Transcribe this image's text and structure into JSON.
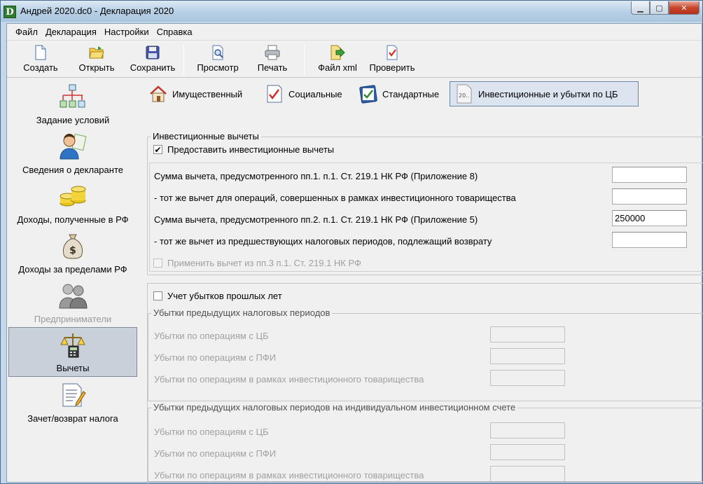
{
  "window": {
    "title": "Андрей 2020.dc0 - Декларация 2020",
    "app_icon_letter": "D"
  },
  "window_buttons": {
    "minimize": "▁",
    "maximize": "▢",
    "close": "✕"
  },
  "menu": [
    "Файл",
    "Декларация",
    "Настройки",
    "Справка"
  ],
  "toolbar": [
    {
      "label": "Создать",
      "icon": "new-document-icon"
    },
    {
      "label": "Открыть",
      "icon": "open-folder-icon"
    },
    {
      "label": "Сохранить",
      "icon": "save-disk-icon"
    },
    {
      "label": "Просмотр",
      "icon": "preview-icon"
    },
    {
      "label": "Печать",
      "icon": "printer-icon"
    },
    {
      "label": "Файл xml",
      "icon": "xml-file-icon"
    },
    {
      "label": "Проверить",
      "icon": "check-document-icon"
    }
  ],
  "sidebar": [
    {
      "label": "Задание условий",
      "icon": "conditions-tree-icon",
      "state": "normal"
    },
    {
      "label": "Сведения о декларанте",
      "icon": "person-icon",
      "state": "normal"
    },
    {
      "label": "Доходы, полученные в РФ",
      "icon": "coins-icon",
      "state": "normal"
    },
    {
      "label": "Доходы за пределами РФ",
      "icon": "money-bag-icon",
      "state": "normal"
    },
    {
      "label": "Предприниматели",
      "icon": "businessmen-icon",
      "state": "disabled"
    },
    {
      "label": "Вычеты",
      "icon": "scales-calculator-icon",
      "state": "active"
    },
    {
      "label": "Зачет/возврат налога",
      "icon": "document-pen-icon",
      "state": "normal"
    }
  ],
  "tabs": [
    {
      "label": "Имущественный",
      "icon": "house-icon",
      "active": false
    },
    {
      "label": "Социальные",
      "icon": "checklist-icon",
      "active": false
    },
    {
      "label": "Стандартные",
      "icon": "clipboard-check-icon",
      "active": false
    },
    {
      "label": "Инвестиционные и убытки по ЦБ",
      "icon": "document-20-icon",
      "active": true,
      "icon_text": "20.."
    }
  ],
  "investment": {
    "group_title": "Инвестиционные вычеты",
    "provide_checkbox": {
      "label": "Предоставить инвестиционные вычеты",
      "checked": true,
      "mark": "✔"
    },
    "rows": [
      {
        "label": "Сумма вычета, предусмотренного пп.1. п.1. Ст. 219.1 НК РФ (Приложение 8)",
        "value": ""
      },
      {
        "label": " - тот же вычет для операций, совершенных в рамках инвестиционного товарищества",
        "value": ""
      },
      {
        "label": "Сумма вычета, предусмотренного пп.2. п.1. Ст. 219.1 НК РФ (Приложение 5)",
        "value": "250000"
      },
      {
        "label": " - тот же вычет из предшествующих налоговых периодов, подлежащий возврату",
        "value": ""
      }
    ],
    "apply_checkbox": {
      "label": "Применить вычет из пп.3 п.1. Ст. 219.1 НК РФ",
      "checked": false,
      "disabled": true
    }
  },
  "losses": {
    "checkbox": {
      "label": "Учет убытков прошлых лет",
      "checked": false
    },
    "prev_group": {
      "title": "Убытки предыдущих налоговых периодов",
      "rows": [
        {
          "label": "Убытки по операциям с ЦБ",
          "value": ""
        },
        {
          "label": "Убытки по операциям с ПФИ",
          "value": ""
        },
        {
          "label": "Убытки по операциям в рамках инвестиционного товарищества",
          "value": ""
        }
      ]
    },
    "iis_group": {
      "title": "Убытки предыдущих налоговых периодов на индивидуальном инвестиционном счете",
      "rows": [
        {
          "label": "Убытки по операциям с ЦБ",
          "value": ""
        },
        {
          "label": "Убытки по операциям с ПФИ",
          "value": ""
        },
        {
          "label": "Убытки по операциям в рамках инвестиционного товарищества",
          "value": ""
        }
      ]
    }
  }
}
